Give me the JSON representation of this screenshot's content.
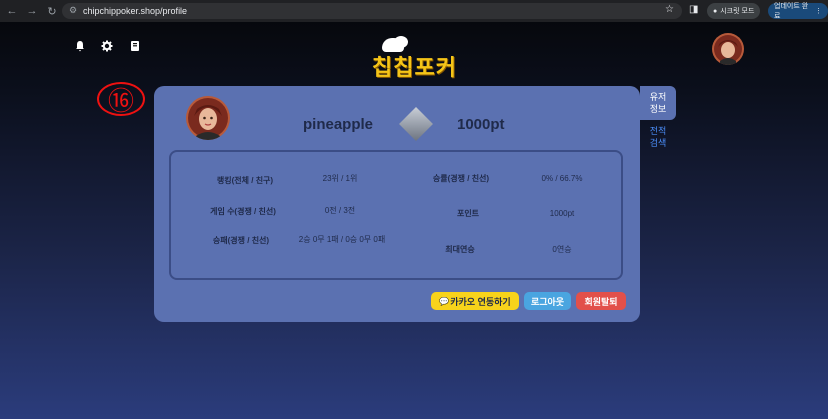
{
  "browser": {
    "back": "←",
    "forward": "→",
    "reload": "↻",
    "site_icon": "⚙",
    "url": "chipchippoker.shop/profile",
    "star": "☆",
    "side_panel": "◨",
    "secret_mode": "시크릿 모드",
    "update": "업데이트 완료",
    "menu": "⋮"
  },
  "header": {
    "logo": "칩칩포커",
    "icons": [
      "bell-icon",
      "gear-icon",
      "book-icon"
    ]
  },
  "annotation": "⑯",
  "side_tabs": {
    "user_info": [
      "유저",
      "정보"
    ],
    "match_history": [
      "전적",
      "검색"
    ]
  },
  "profile": {
    "username": "pineapple",
    "points": "1000pt",
    "stats": {
      "ranking_label": "랭킹(전체 / 친구)",
      "ranking_value": "23위 / 1위",
      "winrate_label": "승률(경쟁 / 친선)",
      "winrate_value": "0% / 66.7%",
      "games_label": "게임 수(경쟁 / 친선)",
      "games_value": "0전 / 3전",
      "point_label": "포인트",
      "point_value": "1000pt",
      "record_label": "승패(경쟁 / 친선)",
      "record_value": "2승 0무 1패 / 0승 0무 0패",
      "streak_label": "최대연승",
      "streak_value": "0연승"
    },
    "buttons": {
      "kakao": "카카오 연동하기",
      "logout": "로그아웃",
      "withdraw": "회원탈퇴"
    }
  }
}
